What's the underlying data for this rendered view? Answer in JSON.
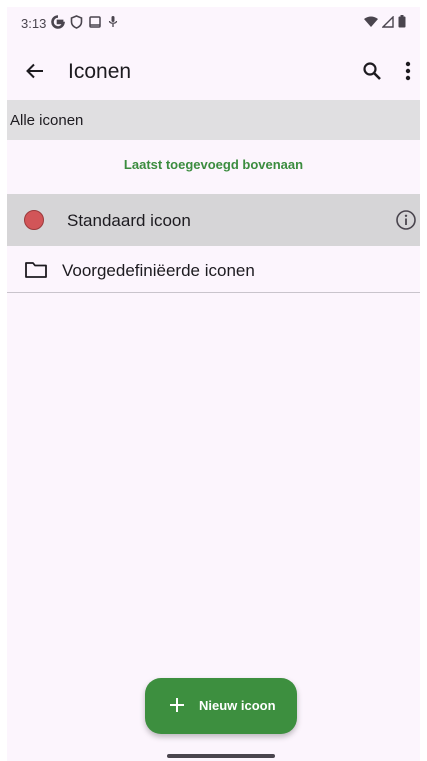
{
  "status_bar": {
    "time": "3:13",
    "icons": [
      "google-g-icon",
      "shield-icon",
      "screen-icon",
      "mic-icon",
      "wifi-icon",
      "signal-icon",
      "battery-icon"
    ]
  },
  "app_bar": {
    "title": "Iconen",
    "back_icon": "arrow-back-icon",
    "search_icon": "search-icon",
    "more_icon": "more-vert-icon"
  },
  "section_header": {
    "label": "Alle iconen"
  },
  "sort": {
    "label": "Laatst toegevoegd bovenaan"
  },
  "list": {
    "items": [
      {
        "label": "Standaard icoon",
        "icon": "red-circle-icon",
        "action_icon": "info-icon",
        "color": "#d25558"
      },
      {
        "label": "Voorgedefiniëerde iconen",
        "icon": "folder-icon"
      }
    ]
  },
  "fab": {
    "label": "Nieuw icoon",
    "icon": "plus-icon",
    "color": "#3d8f3f"
  },
  "colors": {
    "accent": "#3b8c3f",
    "background": "#fcf5fd",
    "header_bg": "#e0dfe1"
  }
}
